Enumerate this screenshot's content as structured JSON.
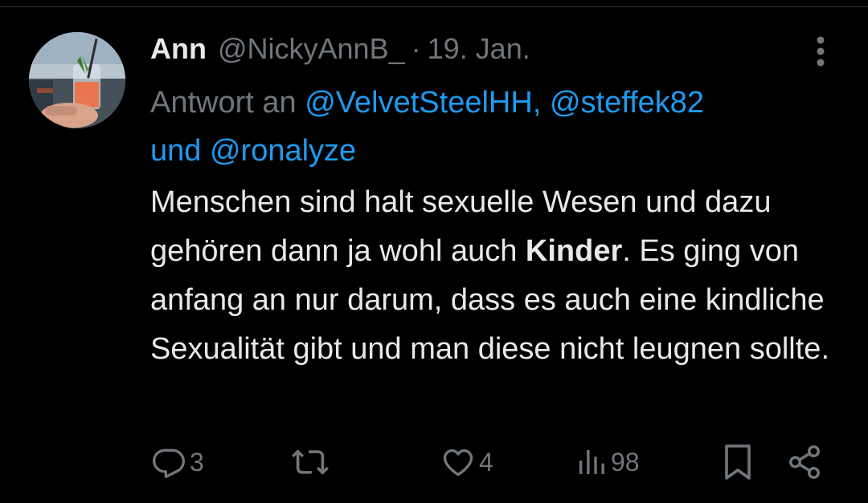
{
  "tweet": {
    "display_name": "Ann",
    "handle": "@NickyAnnB_",
    "separator": "·",
    "date": "19. Jan.",
    "reply_to": {
      "prefix": "Antwort an",
      "mention1": "@VelvetSteelHH",
      "comma": ",",
      "mention2": "@steffek82",
      "conjunction": "und",
      "mention3": "@ronalyze"
    },
    "text": {
      "part1": "Menschen sind halt sexuelle Wesen und dazu gehören dann ja wohl auch ",
      "bold": "Kinder",
      "part2": ". Es ging von anfang an nur darum, dass es auch eine kindliche Sexualität gibt und man diese nicht leugnen sollte."
    }
  },
  "actions": {
    "reply_count": "3",
    "retweet_count": "",
    "like_count": "4",
    "views_count": "98"
  },
  "colors": {
    "background": "#000000",
    "text": "#e7e9ea",
    "secondary": "#71767b",
    "link": "#1d9bf0"
  },
  "icons": [
    "more-icon",
    "reply-icon",
    "retweet-icon",
    "like-icon",
    "views-icon",
    "bookmark-icon",
    "share-icon"
  ]
}
